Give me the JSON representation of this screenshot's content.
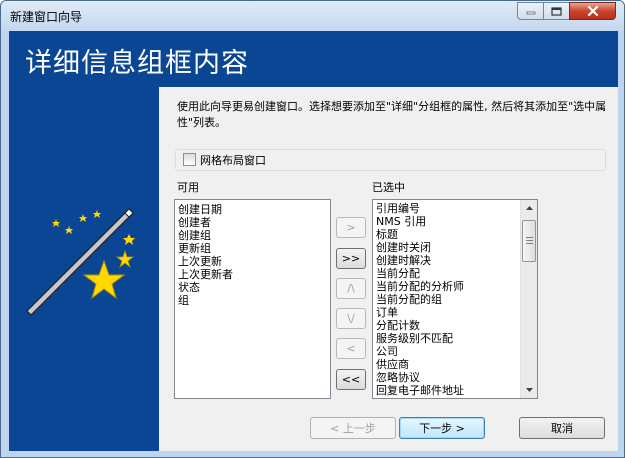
{
  "window": {
    "title": "新建窗口向导",
    "controls": {
      "minimize_icon": "minimize-icon",
      "maximize_icon": "maximize-icon",
      "close_icon": "close-icon"
    }
  },
  "banner": {
    "title": "详细信息组框内容",
    "image_icon": "magic-wand-stars-icon"
  },
  "description": "使用此向导更易创建窗口。选择想要添加至\"详细\"分组框的属性, 然后将其添加至\"选中属性\"列表。",
  "grid_layout": {
    "label": "网格布局窗口",
    "checked": false
  },
  "available": {
    "label": "可用",
    "items": [
      "创建日期",
      "创建者",
      "创建组",
      "更新组",
      "上次更新",
      "上次更新者",
      "状态",
      "组"
    ]
  },
  "selected": {
    "label": "已选中",
    "items": [
      "引用编号",
      "NMS 引用",
      "标题",
      "创建时关闭",
      "创建时解决",
      "当前分配",
      "当前分配的分析师",
      "当前分配的组",
      "订单",
      "分配计数",
      "服务级别不匹配",
      "公司",
      "供应商",
      "忽略协议",
      "回复电子邮件地址"
    ]
  },
  "move_buttons": {
    "add_one": ">",
    "add_all": ">>",
    "move_up": "/\\",
    "move_down": "\\/",
    "remove_one": "<",
    "remove_all": "<<"
  },
  "footer": {
    "prev": "< 上一步",
    "next": "下一步 >",
    "cancel": "取消"
  }
}
